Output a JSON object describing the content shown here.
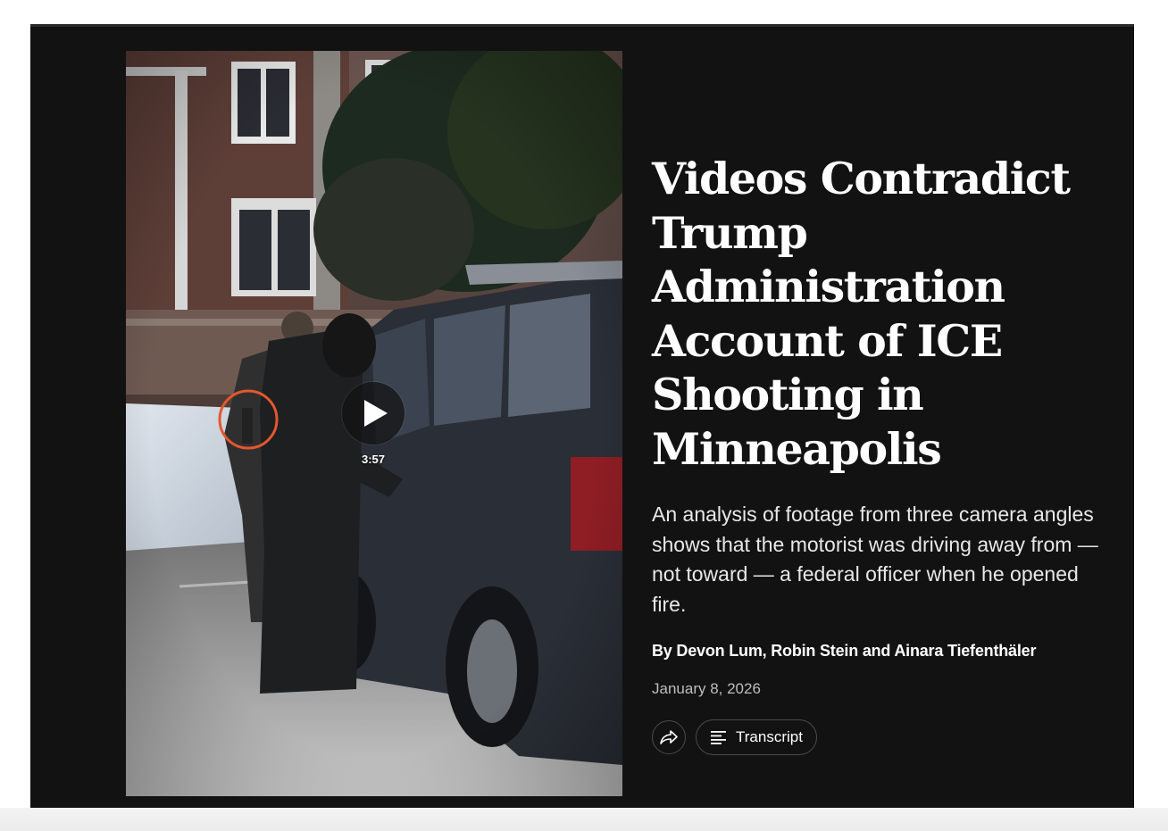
{
  "video": {
    "duration": "3:57",
    "play_icon": "play-icon",
    "annotation": "orange-circle-highlight"
  },
  "article": {
    "headline": "Videos Contradict Trump Administration Account of ICE Shooting in Minneapolis",
    "summary": "An analysis of footage from three camera angles shows that the motorist was driving away from — not toward — a federal officer when he opened fire.",
    "byline": "By Devon Lum, Robin Stein and Ainara Tiefenthäler",
    "date": "January 8, 2026"
  },
  "actions": {
    "share_icon": "share-icon",
    "transcript_icon": "transcript-icon",
    "transcript_label": "Transcript"
  },
  "colors": {
    "module_background": "#121212",
    "annotation_circle": "#e4572e",
    "text_primary": "#ffffff",
    "text_secondary": "#bdbdbd"
  }
}
